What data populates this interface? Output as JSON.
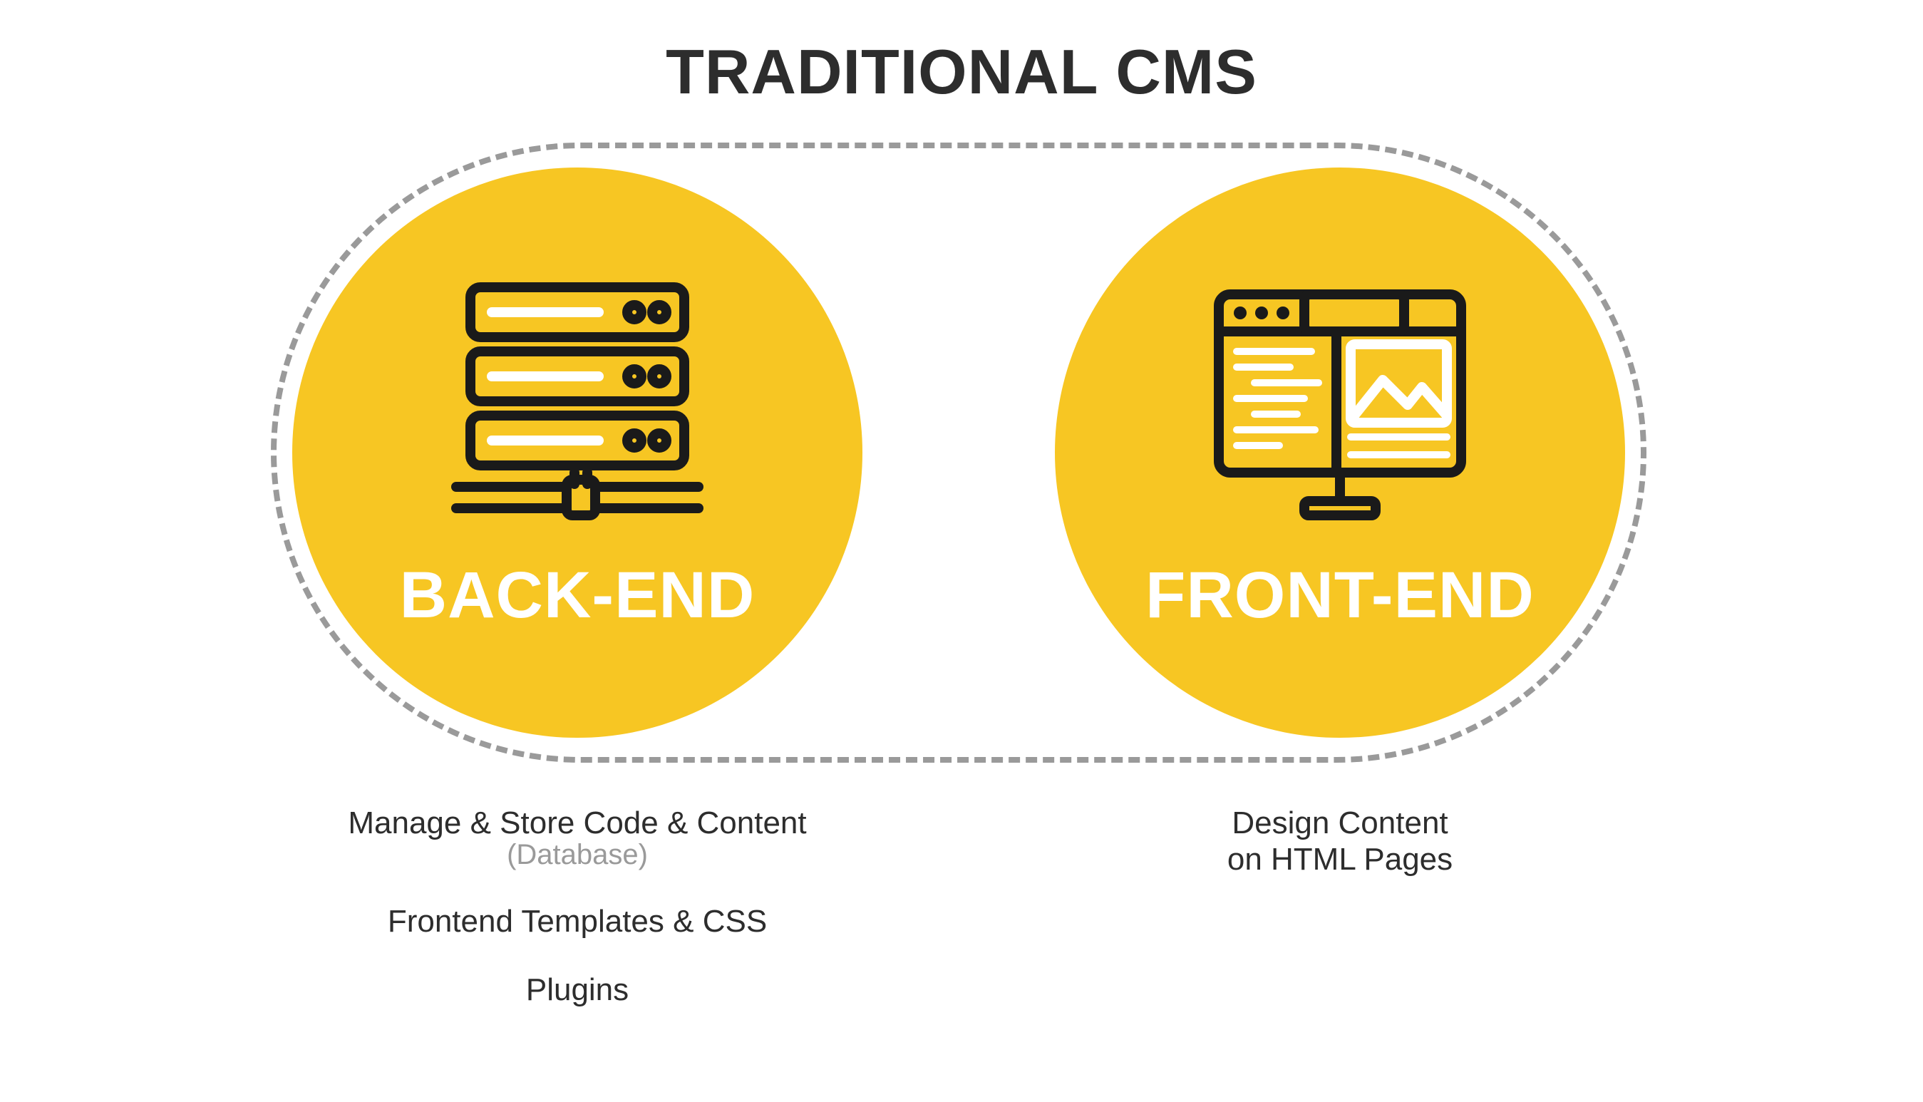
{
  "title": "TRADITIONAL CMS",
  "colors": {
    "circle": "#f7c623",
    "dash": "#9a9a9a",
    "text_dark": "#2d2d2d",
    "text_muted": "#9a9a9a",
    "label_white": "#ffffff",
    "icon_stroke": "#1a1a1a"
  },
  "left": {
    "icon": "server-stack-icon",
    "label": "BACK-END",
    "caption_line1": "Manage & Store Code & Content",
    "caption_line1_sub": "(Database)",
    "caption_line2": "Frontend Templates & CSS",
    "caption_line3": "Plugins"
  },
  "right": {
    "icon": "webpage-monitor-icon",
    "label": "FRONT-END",
    "caption_line1": "Design Content",
    "caption_line1b": "on HTML Pages"
  }
}
